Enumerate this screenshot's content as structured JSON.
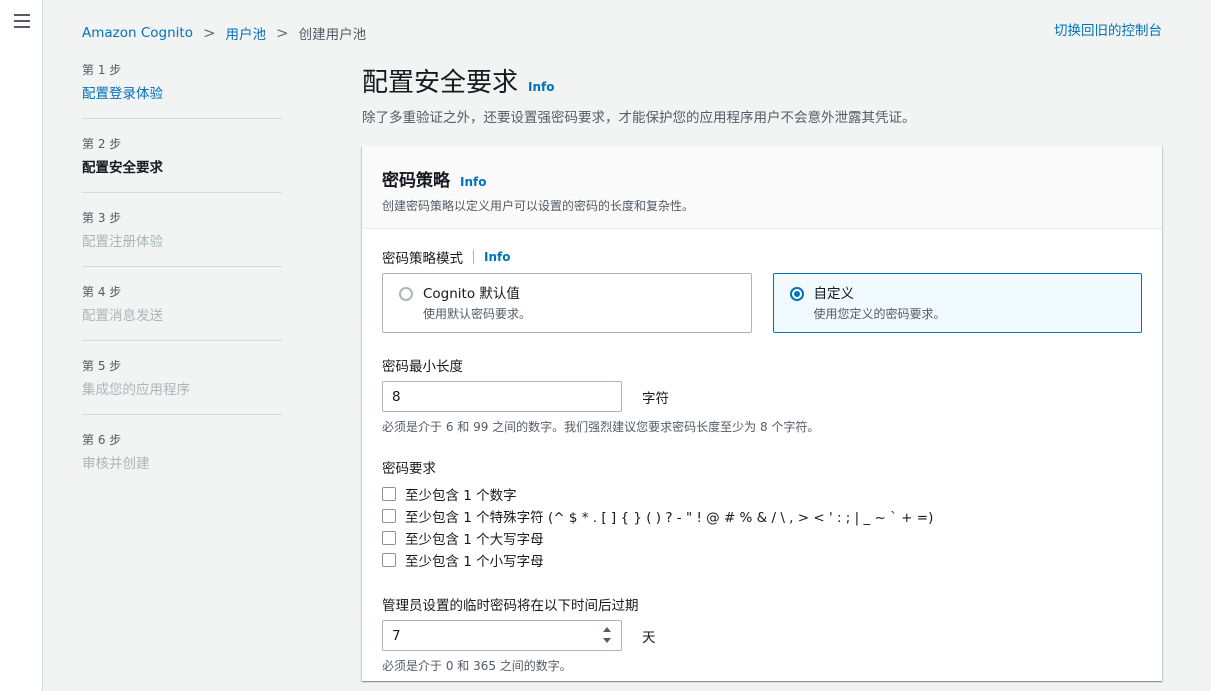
{
  "breadcrumb": {
    "items": [
      "Amazon Cognito",
      "用户池"
    ],
    "current": "创建用户池",
    "separator": ">"
  },
  "switch_console": "切换回旧的控制台",
  "steps": [
    {
      "num": "第 1 步",
      "title": "配置登录体验",
      "state": "link"
    },
    {
      "num": "第 2 步",
      "title": "配置安全要求",
      "state": "active"
    },
    {
      "num": "第 3 步",
      "title": "配置注册体验",
      "state": "disabled"
    },
    {
      "num": "第 4 步",
      "title": "配置消息发送",
      "state": "disabled"
    },
    {
      "num": "第 5 步",
      "title": "集成您的应用程序",
      "state": "disabled"
    },
    {
      "num": "第 6 步",
      "title": "审核并创建",
      "state": "disabled"
    }
  ],
  "page": {
    "title": "配置安全要求",
    "info": "Info",
    "description": "除了多重验证之外，还要设置强密码要求，才能保护您的应用程序用户不会意外泄露其凭证。"
  },
  "password_policy": {
    "title": "密码策略",
    "info": "Info",
    "subtitle": "创建密码策略以定义用户可以设置的密码的长度和复杂性。",
    "mode_label": "密码策略模式",
    "mode_info": "Info",
    "modes": [
      {
        "title": "Cognito 默认值",
        "desc": "使用默认密码要求。",
        "selected": false
      },
      {
        "title": "自定义",
        "desc": "使用您定义的密码要求。",
        "selected": true
      }
    ],
    "min_length_label": "密码最小长度",
    "min_length_value": "8",
    "min_length_unit": "字符",
    "min_length_hint": "必须是介于 6 和 99 之间的数字。我们强烈建议您要求密码长度至少为 8 个字符。",
    "requirements_label": "密码要求",
    "requirements": [
      "至少包含 1 个数字",
      "至少包含 1 个特殊字符 (^ $ * . [ ] { } ( ) ? - \" ! @ # % & / \\ , > < ' : ; | _ ~ ` + =)",
      "至少包含 1 个大写字母",
      "至少包含 1 个小写字母"
    ],
    "temp_expiry_label": "管理员设置的临时密码将在以下时间后过期",
    "temp_expiry_value": "7",
    "temp_expiry_unit": "天",
    "temp_expiry_hint": "必须是介于 0 和 365 之间的数字。"
  },
  "colors": {
    "link": "#0073bb",
    "text": "#16191f",
    "secondary": "#545b64",
    "disabled": "#aab7b8",
    "selected_bg": "#f1faff"
  }
}
